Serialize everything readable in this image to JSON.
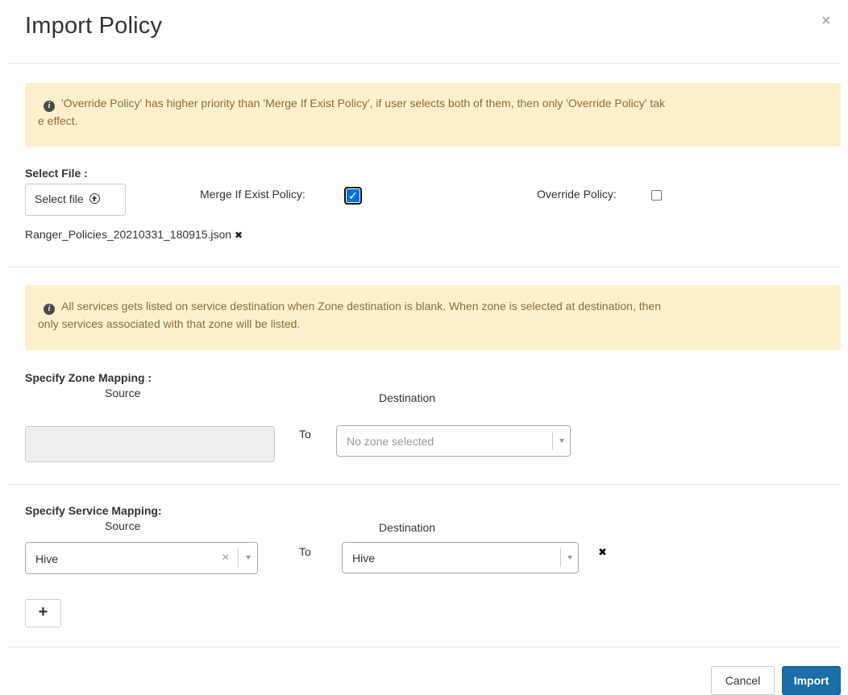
{
  "modal": {
    "title": "Import Policy",
    "close_glyph": "×"
  },
  "alerts": {
    "priority": {
      "icon": "info-circle-icon",
      "line1": "'Override Policy' has higher priority than 'Merge If Exist Policy', if user selects both of them, then only 'Override Policy' tak",
      "line2": "e effect."
    },
    "zone": {
      "icon": "info-circle-icon",
      "line1": "All services gets listed on service destination when Zone destination is blank. When zone is selected at destination, then",
      "line2": "only services associated with that zone will be listed."
    }
  },
  "file": {
    "section_label": "Select File :",
    "select_button_label": "Select file",
    "select_button_icon": "upload-circle-icon",
    "merge_label": "Merge If Exist Policy:",
    "merge_checked": true,
    "override_label": "Override Policy:",
    "override_checked": false,
    "selected_file_name": "Ranger_Policies_20210331_180915.json",
    "remove_file_glyph": "✖"
  },
  "zone_mapping": {
    "section_label": "Specify Zone Mapping :",
    "source_header": "Source",
    "destination_header": "Destination",
    "to_label": "To",
    "source_value": "",
    "destination_placeholder": "No zone selected"
  },
  "service_mapping": {
    "section_label": "Specify Service Mapping:",
    "source_header": "Source",
    "destination_header": "Destination",
    "to_label": "To",
    "rows": [
      {
        "source": "Hive",
        "destination": "Hive"
      }
    ],
    "clear_glyph": "×",
    "remove_row_glyph": "✖",
    "add_row_glyph": "+"
  },
  "footer": {
    "cancel_label": "Cancel",
    "import_label": "Import"
  },
  "colors": {
    "alert_bg": "#fcf0cc",
    "alert_text": "#8a6d3b",
    "primary": "#1b6ea6",
    "checkbox_checked": "#0b6fd7"
  }
}
